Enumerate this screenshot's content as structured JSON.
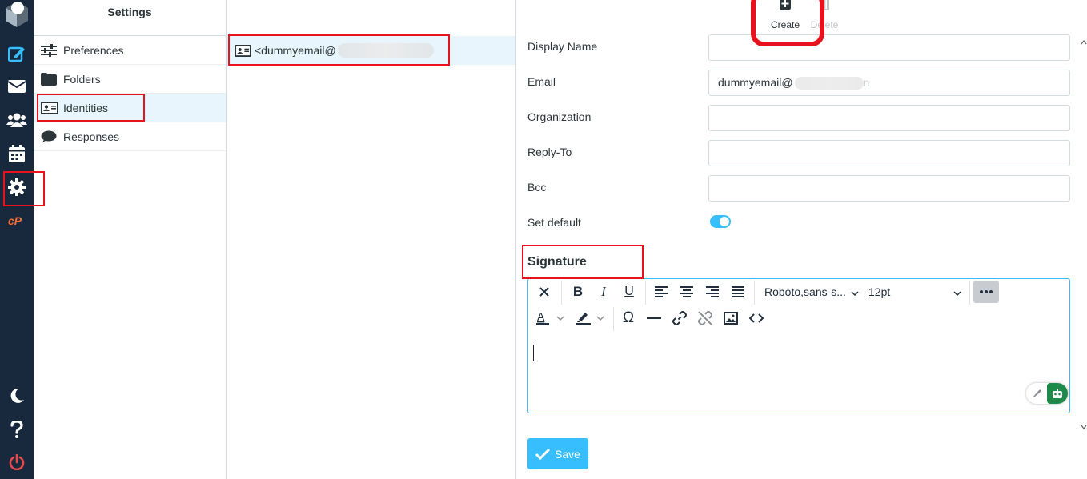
{
  "settings": {
    "header": "Settings",
    "items": [
      {
        "label": "Preferences",
        "icon": "sliders-icon"
      },
      {
        "label": "Folders",
        "icon": "folder-icon"
      },
      {
        "label": "Identities",
        "icon": "id-card-icon"
      },
      {
        "label": "Responses",
        "icon": "comment-icon"
      }
    ]
  },
  "identities": {
    "items": [
      {
        "label": "<dummyemail@",
        "icon": "id-card-icon"
      }
    ]
  },
  "toolbar": {
    "create_label": "Create",
    "delete_label": "Delete"
  },
  "form": {
    "display_name_label": "Display Name",
    "display_name_value": "",
    "email_label": "Email",
    "email_value": "dummyemail@",
    "email_tail": "n",
    "organization_label": "Organization",
    "organization_value": "",
    "reply_to_label": "Reply-To",
    "reply_to_value": "",
    "bcc_label": "Bcc",
    "bcc_value": "",
    "set_default_label": "Set default",
    "set_default_on": true
  },
  "signature": {
    "title": "Signature",
    "font_family": "Roboto,sans-s...",
    "font_size": "12pt"
  },
  "save_label": "Save",
  "colors": {
    "sidebar_bg": "#18293d",
    "accent": "#37beff",
    "selected_row": "#e9f5fc",
    "annotation": "#e8121e",
    "logout": "#e8484c",
    "cpanel": "#ff6c2c"
  }
}
